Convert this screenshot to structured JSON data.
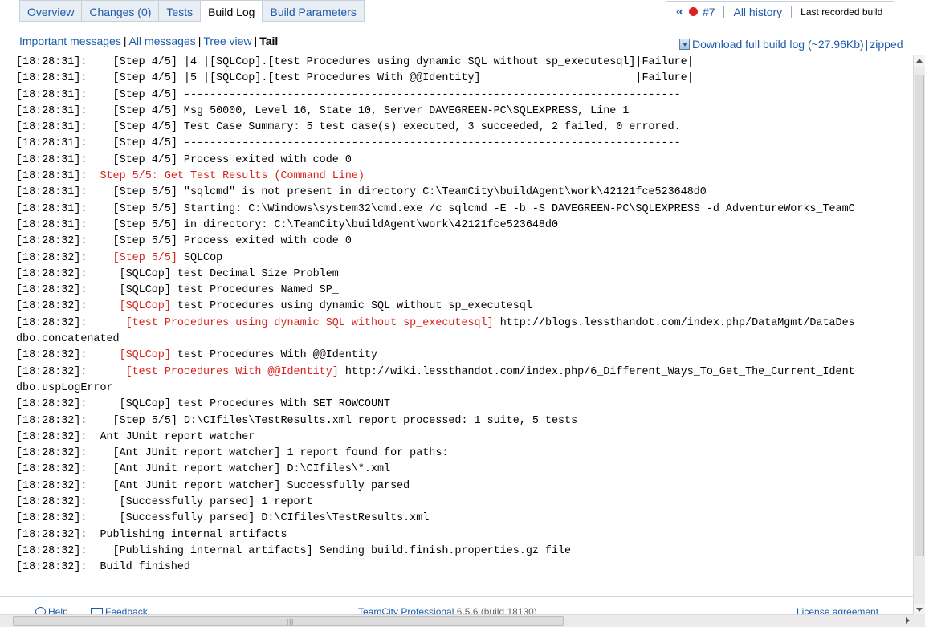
{
  "tabs": [
    {
      "label": "Overview"
    },
    {
      "label": "Changes (0)"
    },
    {
      "label": "Tests"
    },
    {
      "label": "Build Log",
      "active": true
    },
    {
      "label": "Build Parameters"
    }
  ],
  "history": {
    "prev_glyph": "«",
    "build_number": "#7",
    "status_color": "#e02020",
    "all_history": "All history",
    "last_recorded": "Last recorded build"
  },
  "filters": {
    "important": "Important messages",
    "all": "All messages",
    "tree": "Tree view",
    "tail": "Tail"
  },
  "download": {
    "full_log": "Download full build log (~27.96Kb)",
    "zipped": "zipped"
  },
  "log_lines": [
    [
      {
        "t": "[18:28:31]:    [Step 4/5] |4 |[SQLCop].[test Procedures using dynamic SQL without sp_executesql]|Failure|"
      }
    ],
    [
      {
        "t": "[18:28:31]:    [Step 4/5] |5 |[SQLCop].[test Procedures With @@Identity]                        |Failure|"
      }
    ],
    [
      {
        "t": "[18:28:31]:    [Step 4/5] -----------------------------------------------------------------------------"
      }
    ],
    [
      {
        "t": "[18:28:31]:    [Step 4/5] Msg 50000, Level 16, State 10, Server DAVEGREEN-PC\\SQLEXPRESS, Line 1"
      }
    ],
    [
      {
        "t": "[18:28:31]:    [Step 4/5] Test Case Summary: 5 test case(s) executed, 3 succeeded, 2 failed, 0 errored."
      }
    ],
    [
      {
        "t": "[18:28:31]:    [Step 4/5] -----------------------------------------------------------------------------"
      }
    ],
    [
      {
        "t": "[18:28:31]:    [Step 4/5] Process exited with code 0"
      }
    ],
    [
      {
        "t": "[18:28:31]:  "
      },
      {
        "t": "Step 5/5: Get Test Results (Command Line)",
        "red": true
      }
    ],
    [
      {
        "t": "[18:28:31]:    [Step 5/5] \"sqlcmd\" is not present in directory C:\\TeamCity\\buildAgent\\work\\42121fce523648d0"
      }
    ],
    [
      {
        "t": "[18:28:31]:    [Step 5/5] Starting: C:\\Windows\\system32\\cmd.exe /c sqlcmd -E -b -S DAVEGREEN-PC\\SQLEXPRESS -d AdventureWorks_TeamC"
      }
    ],
    [
      {
        "t": "[18:28:31]:    [Step 5/5] in directory: C:\\TeamCity\\buildAgent\\work\\42121fce523648d0"
      }
    ],
    [
      {
        "t": "[18:28:32]:    [Step 5/5] Process exited with code 0"
      }
    ],
    [
      {
        "t": "[18:28:32]:    "
      },
      {
        "t": "[Step 5/5]",
        "red": true
      },
      {
        "t": " SQLCop"
      }
    ],
    [
      {
        "t": "[18:28:32]:     [SQLCop] test Decimal Size Problem"
      }
    ],
    [
      {
        "t": "[18:28:32]:     [SQLCop] test Procedures Named SP_"
      }
    ],
    [
      {
        "t": "[18:28:32]:     "
      },
      {
        "t": "[SQLCop]",
        "red": true
      },
      {
        "t": " test Procedures using dynamic SQL without sp_executesql"
      }
    ],
    [
      {
        "t": "[18:28:32]:      "
      },
      {
        "t": "[test Procedures using dynamic SQL without sp_executesql]",
        "red": true
      },
      {
        "t": " http://blogs.lessthandot.com/index.php/DataMgmt/DataDes"
      }
    ],
    [
      {
        "t": "dbo.concatenated"
      }
    ],
    [
      {
        "t": "[18:28:32]:     "
      },
      {
        "t": "[SQLCop]",
        "red": true
      },
      {
        "t": " test Procedures With @@Identity"
      }
    ],
    [
      {
        "t": "[18:28:32]:      "
      },
      {
        "t": "[test Procedures With @@Identity]",
        "red": true
      },
      {
        "t": " http://wiki.lessthandot.com/index.php/6_Different_Ways_To_Get_The_Current_Ident"
      }
    ],
    [
      {
        "t": "dbo.uspLogError"
      }
    ],
    [
      {
        "t": "[18:28:32]:     [SQLCop] test Procedures With SET ROWCOUNT"
      }
    ],
    [
      {
        "t": "[18:28:32]:    [Step 5/5] D:\\CIfiles\\TestResults.xml report processed: 1 suite, 5 tests"
      }
    ],
    [
      {
        "t": "[18:28:32]:  Ant JUnit report watcher"
      }
    ],
    [
      {
        "t": "[18:28:32]:    [Ant JUnit report watcher] 1 report found for paths:"
      }
    ],
    [
      {
        "t": "[18:28:32]:    [Ant JUnit report watcher] D:\\CIfiles\\*.xml"
      }
    ],
    [
      {
        "t": "[18:28:32]:    [Ant JUnit report watcher] Successfully parsed"
      }
    ],
    [
      {
        "t": "[18:28:32]:     [Successfully parsed] 1 report"
      }
    ],
    [
      {
        "t": "[18:28:32]:     [Successfully parsed] D:\\CIfiles\\TestResults.xml"
      }
    ],
    [
      {
        "t": "[18:28:32]:  Publishing internal artifacts"
      }
    ],
    [
      {
        "t": "[18:28:32]:    [Publishing internal artifacts] Sending build.finish.properties.gz file"
      }
    ],
    [
      {
        "t": "[18:28:32]:  Build finished"
      }
    ]
  ],
  "footer": {
    "help": "Help",
    "feedback": "Feedback",
    "product": "TeamCity Professional",
    "version": "6.5.6 (build 18130)",
    "license": "License agreement"
  },
  "colors": {
    "link": "#1c5cab",
    "error": "#d9201a"
  }
}
